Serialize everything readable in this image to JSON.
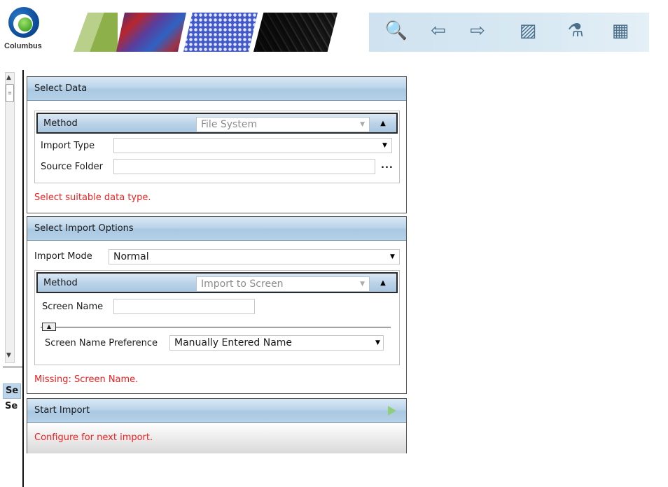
{
  "app": {
    "logo_text": "Columbus",
    "logo_mark": "Columbus-logo"
  },
  "toolbar": {
    "icons": [
      "search-globe-icon",
      "import-icon",
      "export-icon",
      "image-zoom-icon",
      "analysis-icon",
      "table-chart-icon"
    ]
  },
  "side": {
    "tab1_label": "Se",
    "tab2_label": "Se"
  },
  "select_data": {
    "title": "Select Data",
    "method_label": "Method",
    "method_value": "File System",
    "import_type_label": "Import Type",
    "import_type_value": "",
    "source_folder_label": "Source Folder",
    "source_folder_value": "",
    "browse_label": "...",
    "error": "Select suitable data type."
  },
  "import_options": {
    "title": "Select Import Options",
    "import_mode_label": "Import Mode",
    "import_mode_value": "Normal",
    "method_label": "Method",
    "method_value": "Import to Screen",
    "screen_name_label": "Screen Name",
    "screen_name_value": "",
    "preference_label": "Screen Name Preference",
    "preference_value": "Manually Entered Name",
    "error": "Missing: Screen Name."
  },
  "start_import": {
    "title": "Start Import",
    "status": "Configure for next import."
  },
  "colors": {
    "error": "#ee2020",
    "panel_header": "#bcd5ea",
    "accent_green": "#8fcf7b"
  }
}
